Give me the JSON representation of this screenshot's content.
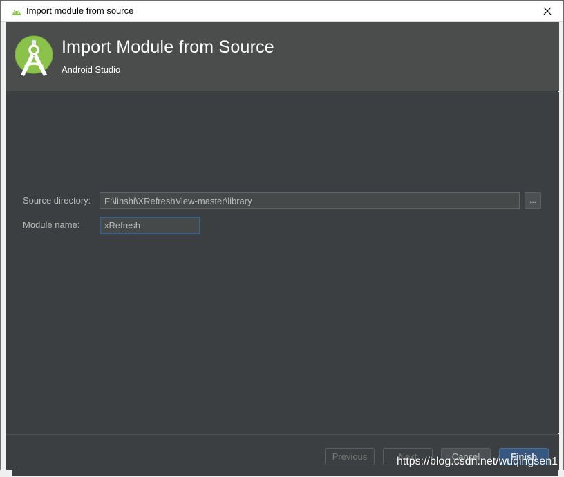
{
  "window": {
    "title": "Import module from source",
    "close_glyph": "✕"
  },
  "header": {
    "title": "Import Module from Source",
    "subtitle": "Android Studio",
    "logo_icon": "android-studio-logo-icon"
  },
  "form": {
    "source_directory": {
      "label": "Source directory:",
      "value": "F:\\linshi\\XRefreshView-master\\library",
      "browse_label": "..."
    },
    "module_name": {
      "label": "Module name:",
      "value": "xRefresh"
    }
  },
  "footer": {
    "previous_label": "Previous",
    "next_label": "Next",
    "cancel_label": "Cancel",
    "finish_label": "Finish"
  },
  "watermark": "https://blog.csdn.net/wuqingsen1",
  "colors": {
    "background": "#3c3f41",
    "header": "#4b4d4d",
    "accent": "#365880",
    "android_green": "#8bc34a"
  }
}
